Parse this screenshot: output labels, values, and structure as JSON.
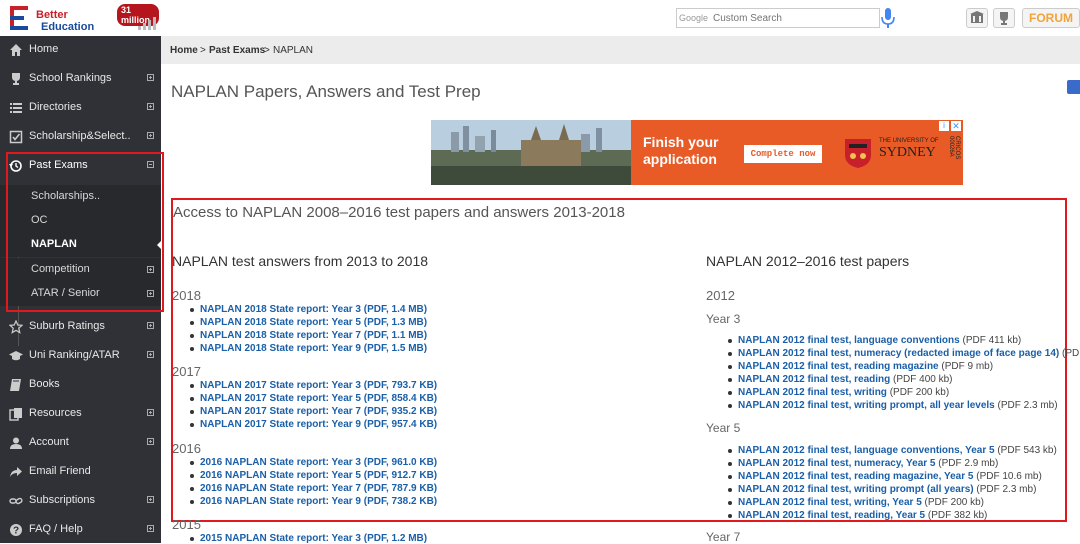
{
  "header": {
    "logo_line1": "Better",
    "logo_line2": "Education",
    "badge": "31 million",
    "search_google": "Google",
    "search_placeholder": "Custom Search",
    "forum_label": "FORUM"
  },
  "sidebar": {
    "items": [
      {
        "label": "Home",
        "icon": "home-icon",
        "top": 0
      },
      {
        "label": "School Rankings",
        "icon": "trophy-icon"
      },
      {
        "label": "Directories",
        "icon": "list-icon"
      },
      {
        "label": "Scholarship&Select..",
        "icon": "checkbox-icon"
      },
      {
        "label": "Past Exams",
        "icon": "history-icon"
      }
    ],
    "sub_items": [
      "Scholarships..",
      "OC",
      "NAPLAN",
      "Competition",
      "ATAR / Senior"
    ],
    "items_after": [
      "Suburb Ratings",
      "Uni Ranking/ATAR",
      "Books",
      "Resources",
      "Account",
      "Email Friend",
      "Subscriptions",
      "FAQ / Help"
    ]
  },
  "breadcrumb": {
    "home": "Home",
    "sep1": ">",
    "past_exams": "Past Exams",
    "sep2": ">",
    "current": "NAPLAN"
  },
  "page": {
    "title": "NAPLAN Papers, Answers and Test Prep",
    "access_heading": "Access to NAPLAN 2008–2016 test papers and answers 2013-2018"
  },
  "ad": {
    "headline1": "Finish your",
    "headline2": "application",
    "button": "Complete now",
    "uni_small": "THE UNIVERSITY OF",
    "uni_name": "SYDNEY",
    "cricos": "CRICOS 00026A",
    "info": "i",
    "close": "✕"
  },
  "left_col": {
    "heading": "NAPLAN test answers from 2013 to 2018",
    "groups": [
      {
        "year": "2018",
        "links": [
          "NAPLAN 2018 State report: Year 3 (PDF, 1.4 MB)",
          "NAPLAN 2018 State report: Year 5 (PDF, 1.3 MB)",
          "NAPLAN 2018 State report: Year 7 (PDF, 1.1 MB)",
          "NAPLAN 2018 State report: Year 9 (PDF, 1.5 MB)"
        ]
      },
      {
        "year": "2017",
        "links": [
          "NAPLAN 2017 State report: Year 3 (PDF, 793.7 KB)",
          "NAPLAN 2017 State report: Year 5 (PDF, 858.4 KB)",
          "NAPLAN 2017 State report: Year 7 (PDF, 935.2 KB)",
          "NAPLAN 2017 State report: Year 9 (PDF, 957.4 KB)"
        ]
      },
      {
        "year": "2016",
        "links": [
          "2016 NAPLAN State report: Year 3 (PDF, 961.0 KB)",
          "2016 NAPLAN State report: Year 5 (PDF, 912.7 KB)",
          "2016 NAPLAN State report: Year 7 (PDF, 787.9 KB)",
          "2016 NAPLAN State report: Year 9 (PDF, 738.2 KB)"
        ]
      },
      {
        "year": "2015",
        "links": [
          "2015 NAPLAN State report: Year 3 (PDF, 1.2 MB)"
        ]
      }
    ]
  },
  "right_col": {
    "heading": "NAPLAN 2012–2016 test papers",
    "year": "2012",
    "sections": [
      {
        "label": "Year 3",
        "links": [
          {
            "text": "NAPLAN 2012 final test, language conventions",
            "suffix": " (PDF 411 kb)"
          },
          {
            "text": "NAPLAN 2012 final test, numeracy (redacted image of face page 14)",
            "suffix": " (PDF"
          },
          {
            "text": "NAPLAN 2012 final test, reading magazine",
            "suffix": " (PDF 9 mb)"
          },
          {
            "text": "NAPLAN 2012 final test, reading",
            "suffix": " (PDF 400 kb)"
          },
          {
            "text": "NAPLAN 2012 final test, writing",
            "suffix": " (PDF 200 kb)"
          },
          {
            "text": "NAPLAN 2012 final test, writing prompt, all year levels",
            "suffix": " (PDF 2.3 mb)"
          }
        ]
      },
      {
        "label": "Year 5",
        "links": [
          {
            "text": "NAPLAN 2012 final test, language conventions, Year 5",
            "suffix": " (PDF 543 kb)"
          },
          {
            "text": "NAPLAN 2012 final test, numeracy, Year 5",
            "suffix": " (PDF 2.9 mb)"
          },
          {
            "text": "NAPLAN 2012 final test, reading magazine, Year 5",
            "suffix": " (PDF 10.6 mb)"
          },
          {
            "text": "NAPLAN 2012 final test, writing prompt (all years)",
            "suffix": " (PDF 2.3 mb)"
          },
          {
            "text": "NAPLAN 2012 final test, writing, Year 5",
            "suffix": " (PDF 200 kb)"
          },
          {
            "text": "NAPLAN 2012 final test, reading, Year 5",
            "suffix": " (PDF 382 kb)"
          }
        ]
      },
      {
        "label": "Year 7",
        "links": []
      }
    ]
  },
  "colors": {
    "sidebar_bg": "#2f3136",
    "link": "#1a5fa8",
    "highlight": "#e0191f",
    "ad_bg": "#e85b27"
  }
}
